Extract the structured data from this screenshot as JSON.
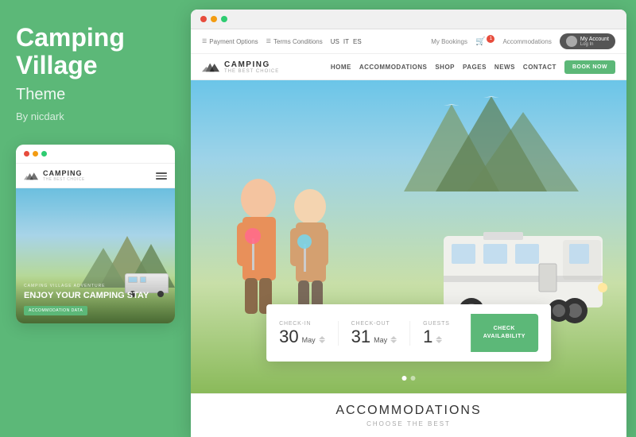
{
  "left": {
    "title": "Camping Village",
    "subtitle": "Theme",
    "author": "By nicdark",
    "dots": [
      "dot1",
      "dot2",
      "dot3"
    ],
    "mobile_logo": "CAMPING",
    "mobile_logo_sub": "THE BEST CHOICE",
    "mobile_hero_tag": "CAMPING VILLAGE ADVENTURE",
    "mobile_hero_title": "ENJOY YOUR CAMPING STAY",
    "mobile_hero_btn": "ACCOMMODATION DATA"
  },
  "browser": {
    "dots": [
      "red",
      "yellow",
      "green"
    ]
  },
  "topbar": {
    "payment": "Payment Options",
    "terms": "Terms Conditions",
    "lang_us": "US",
    "lang_it": "IT",
    "lang_es": "ES",
    "bookings": "My Bookings",
    "accommodations": "Accommodations",
    "account": "My Account",
    "login": "Log In"
  },
  "nav": {
    "logo_name": "CAMPING",
    "logo_tagline": "THE BEST CHOICE",
    "menu_items": [
      "HOME",
      "ACCOMMODATIONS",
      "SHOP",
      "PAGES",
      "NEWS",
      "CONTACT"
    ],
    "book_btn": "BOOK NOW"
  },
  "booking": {
    "checkin_label": "CHECK-IN",
    "checkout_label": "CHECK-OUT",
    "guests_label": "GUESTS",
    "checkin_day": "30",
    "checkin_month": "May",
    "checkout_day": "31",
    "checkout_month": "May",
    "guests_count": "1",
    "check_btn_line1": "CHECK",
    "check_btn_line2": "AVAILABILITY"
  },
  "accommodations": {
    "title": "ACCOMMODATIONS",
    "subtitle": "CHOOSE THE BEST"
  },
  "dots": {
    "active": 0
  }
}
